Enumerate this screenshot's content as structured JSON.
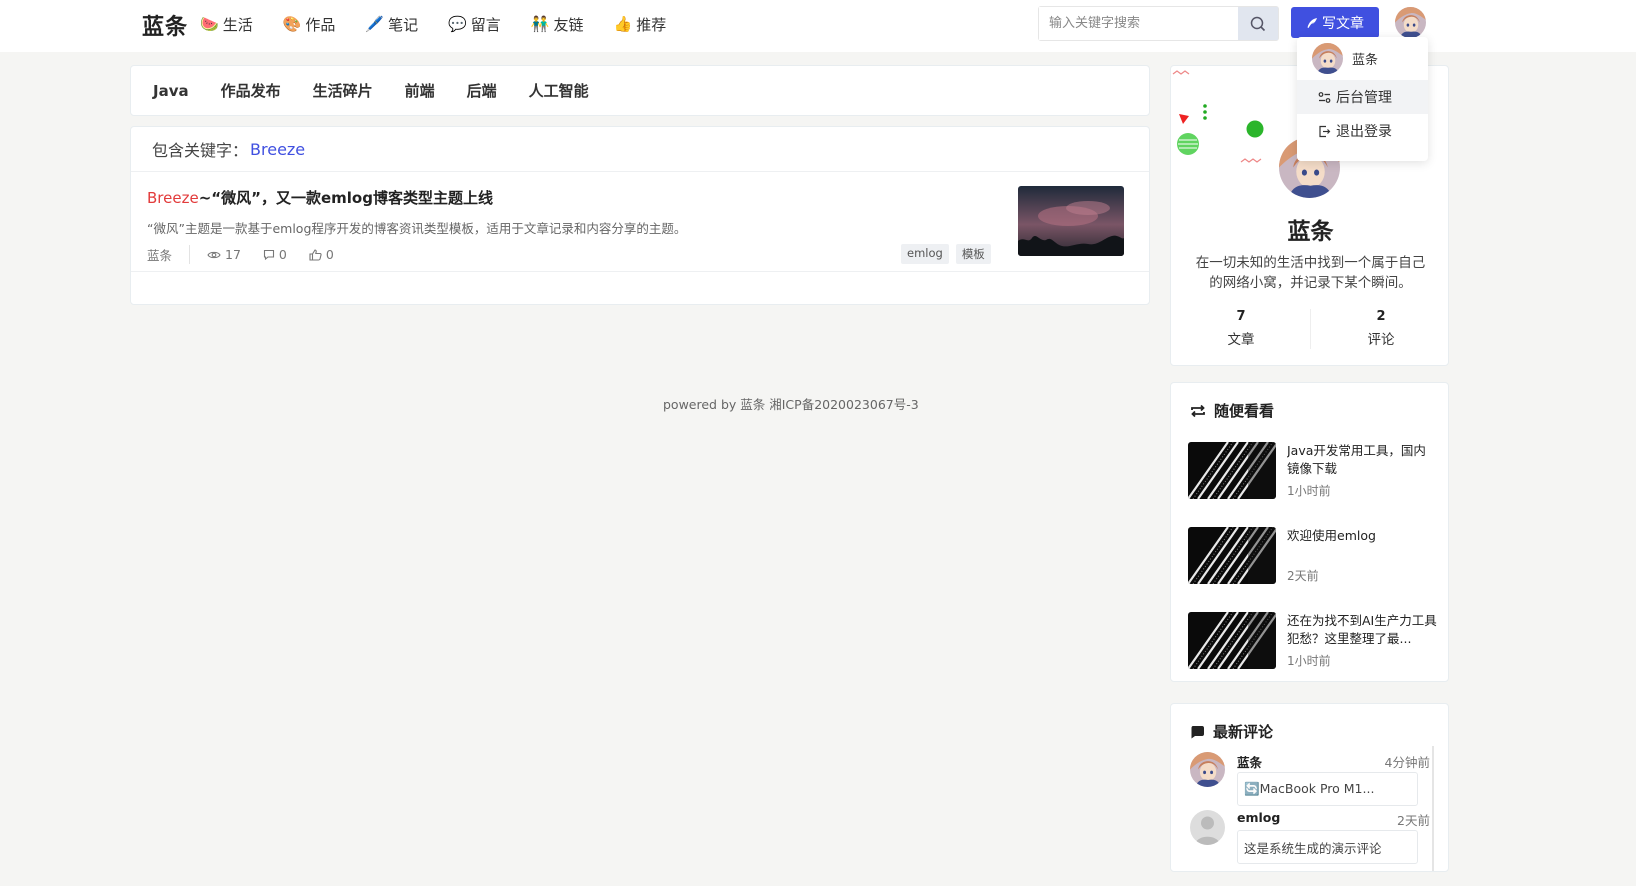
{
  "site": {
    "brand": "蓝条"
  },
  "nav": [
    {
      "emoji": "🍉",
      "label": "生活"
    },
    {
      "emoji": "🎨",
      "label": "作品"
    },
    {
      "emoji": "🖊️",
      "label": "笔记"
    },
    {
      "emoji": "💬",
      "label": "留言"
    },
    {
      "emoji": "👬",
      "label": "友链"
    },
    {
      "emoji": "👍",
      "label": "推荐"
    }
  ],
  "search": {
    "placeholder": "输入关键字搜索"
  },
  "write_button": "写文章",
  "dropdown": {
    "user": "蓝条",
    "admin": "后台管理",
    "logout": "退出登录"
  },
  "categories": [
    "Java",
    "作品发布",
    "生活碎片",
    "前端",
    "后端",
    "人工智能"
  ],
  "results": {
    "label": "包含关键字：",
    "keyword": "Breeze",
    "post": {
      "title_highlight": "Breeze",
      "title_rest": "~“微风”，又一款emlog博客类型主题上线",
      "excerpt": "“微风”主题是一款基于emlog程序开发的博客资讯类型模板，适用于文章记录和内容分享的主题。",
      "author": "蓝条",
      "views": "17",
      "comments": "0",
      "likes": "0",
      "tags": [
        "emlog",
        "模板"
      ]
    }
  },
  "footer": "powered by 蓝条 湘ICP备2020023067号-3",
  "profile": {
    "name": "蓝条",
    "desc": "在一切未知的生活中找到一个属于自己的网络小窝，并记录下某个瞬间。",
    "posts_count": "7",
    "posts_label": "文章",
    "comments_count": "2",
    "comments_label": "评论"
  },
  "random": {
    "title": "随便看看",
    "items": [
      {
        "title": "Java开发常用工具，国内镜像下载",
        "time": "1小时前"
      },
      {
        "title": "欢迎使用emlog",
        "time": "2天前"
      },
      {
        "title": "还在为找不到AI生产力工具犯愁？这里整理了最...",
        "time": "1小时前"
      }
    ]
  },
  "latest_comments": {
    "title": "最新评论",
    "items": [
      {
        "name": "蓝条",
        "time": "4分钟前",
        "text": "🔄MacBook Pro M1..."
      },
      {
        "name": "emlog",
        "time": "2天前",
        "text": "这是系统生成的演示评论"
      }
    ]
  },
  "colors": {
    "accent": "#4050e0",
    "highlight": "#e23b3b",
    "background": "#f5f5f3"
  }
}
